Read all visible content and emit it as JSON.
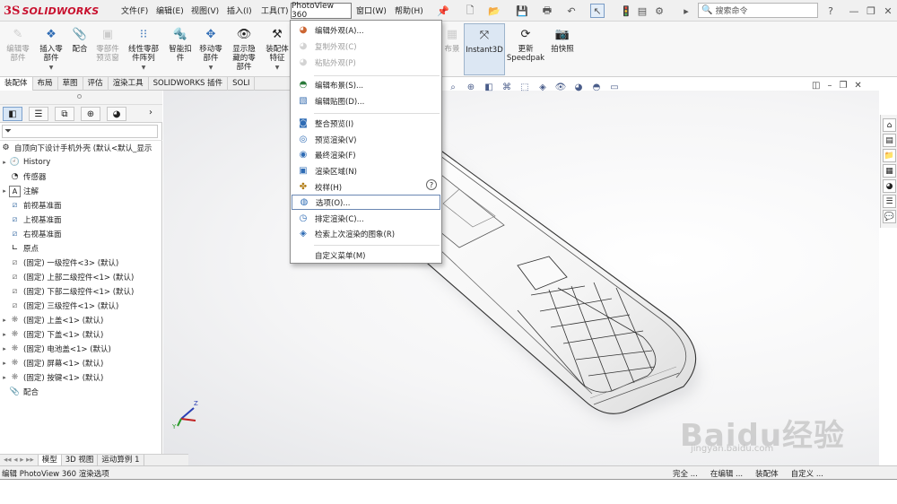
{
  "app": {
    "brand_prefix": "3S",
    "brand": "SOLIDWORKS"
  },
  "menubar": {
    "items": [
      {
        "label": "文件(F)"
      },
      {
        "label": "编辑(E)"
      },
      {
        "label": "视图(V)"
      },
      {
        "label": "插入(I)"
      },
      {
        "label": "工具(T)"
      },
      {
        "label": "PhotoView 360"
      },
      {
        "label": "窗口(W)"
      },
      {
        "label": "帮助(H)"
      }
    ],
    "search_placeholder": "搜索命令"
  },
  "ribbon": {
    "buttons": [
      {
        "label": "编辑零\n部件",
        "enabled": false
      },
      {
        "label": "插入零\n部件",
        "enabled": true
      },
      {
        "label": "配合",
        "enabled": true
      },
      {
        "label": "零部件\n预览窗",
        "enabled": false
      },
      {
        "label": "线性零部\n件阵列",
        "enabled": true
      },
      {
        "label": "智能扣\n件",
        "enabled": true
      },
      {
        "label": "移动零\n部件",
        "enabled": true
      },
      {
        "label": "显示隐\n藏的零\n部件",
        "enabled": true
      },
      {
        "label": "装配体\n特征",
        "enabled": true
      },
      {
        "label": "Instant3D",
        "enabled": true
      },
      {
        "label": "更新\nSpeedpak",
        "enabled": true
      },
      {
        "label": "拍快照",
        "enabled": true
      }
    ]
  },
  "command_tabs": [
    {
      "label": "装配体",
      "active": true
    },
    {
      "label": "布局"
    },
    {
      "label": "草图"
    },
    {
      "label": "评估"
    },
    {
      "label": "渲染工具"
    },
    {
      "label": "SOLIDWORKS 插件"
    },
    {
      "label": "SOLI"
    }
  ],
  "dropdown": {
    "groups": [
      [
        {
          "label": "编辑外观(A)...",
          "icon": "appearance-icon",
          "enabled": true
        },
        {
          "label": "复制外观(C)",
          "icon": "copy-appearance-icon",
          "enabled": false
        },
        {
          "label": "粘贴外观(P)",
          "icon": "paste-appearance-icon",
          "enabled": false
        }
      ],
      [
        {
          "label": "编辑布景(S)...",
          "icon": "scene-icon",
          "enabled": true
        },
        {
          "label": "编辑贴图(D)...",
          "icon": "decal-icon",
          "enabled": true
        }
      ],
      [
        {
          "label": "整合预览(I)",
          "icon": "integrated-preview-icon",
          "enabled": true
        },
        {
          "label": "预览渲染(V)",
          "icon": "preview-render-icon",
          "enabled": true
        },
        {
          "label": "最终渲染(F)",
          "icon": "final-render-icon",
          "enabled": true
        },
        {
          "label": "渲染区域(N)",
          "icon": "render-region-icon",
          "enabled": true
        },
        {
          "label": "校样(H)",
          "icon": "proof-icon",
          "enabled": true
        },
        {
          "label": "选项(O)...",
          "icon": "options-icon",
          "enabled": true,
          "highlighted": true
        },
        {
          "label": "排定渲染(C)...",
          "icon": "schedule-render-icon",
          "enabled": true
        },
        {
          "label": "检索上次渲染的图象(R)",
          "icon": "retrieve-render-icon",
          "enabled": true
        }
      ],
      [
        {
          "label": "自定义菜单(M)",
          "icon": "",
          "enabled": true
        }
      ]
    ],
    "help_badge": "?"
  },
  "tree": {
    "root": "自顶向下设计手机外壳 (默认<默认_显示",
    "items": [
      {
        "label": "History",
        "icon": "history-icon",
        "expandable": true
      },
      {
        "label": "传感器",
        "icon": "sensor-icon",
        "expandable": false
      },
      {
        "label": "注解",
        "icon": "annotation-icon",
        "expandable": true
      },
      {
        "label": "前视基准面",
        "icon": "plane-icon",
        "expandable": false
      },
      {
        "label": "上视基准面",
        "icon": "plane-icon",
        "expandable": false
      },
      {
        "label": "右视基准面",
        "icon": "plane-icon",
        "expandable": false
      },
      {
        "label": "原点",
        "icon": "origin-icon",
        "expandable": false
      },
      {
        "label": "(固定) 一级控件<3> (默认)",
        "icon": "sketch-part-icon",
        "expandable": false
      },
      {
        "label": "(固定) 上部二级控件<1> (默认)",
        "icon": "sketch-part-icon",
        "expandable": false
      },
      {
        "label": "(固定) 下部二级控件<1> (默认)",
        "icon": "sketch-part-icon",
        "expandable": false
      },
      {
        "label": "(固定) 三级控件<1> (默认)",
        "icon": "sketch-part-icon",
        "expandable": false
      },
      {
        "label": "(固定) 上盖<1> (默认)",
        "icon": "part-icon",
        "expandable": true
      },
      {
        "label": "(固定) 下盖<1> (默认)",
        "icon": "part-icon",
        "expandable": true
      },
      {
        "label": "(固定) 电池盖<1> (默认)",
        "icon": "part-icon",
        "expandable": true
      },
      {
        "label": "(固定) 屏幕<1> (默认)",
        "icon": "part-icon",
        "expandable": true
      },
      {
        "label": "(固定) 按键<1> (默认)",
        "icon": "part-icon",
        "expandable": true
      },
      {
        "label": "配合",
        "icon": "mates-icon",
        "expandable": false
      }
    ]
  },
  "bottom_tabs": [
    {
      "label": "模型",
      "active": true
    },
    {
      "label": "3D 视图"
    },
    {
      "label": "运动算例 1"
    }
  ],
  "statusbar": {
    "message": "编辑 PhotoView 360 渲染选项",
    "right": [
      "完全 ...",
      "在编辑 ...",
      "装配体",
      "自定义 ..."
    ]
  },
  "watermark": {
    "text": "Baidu经验",
    "url": "jingyan.baidu.com"
  },
  "colors": {
    "brand": "#c8102e",
    "menu_highlight": "#6b88b3"
  }
}
